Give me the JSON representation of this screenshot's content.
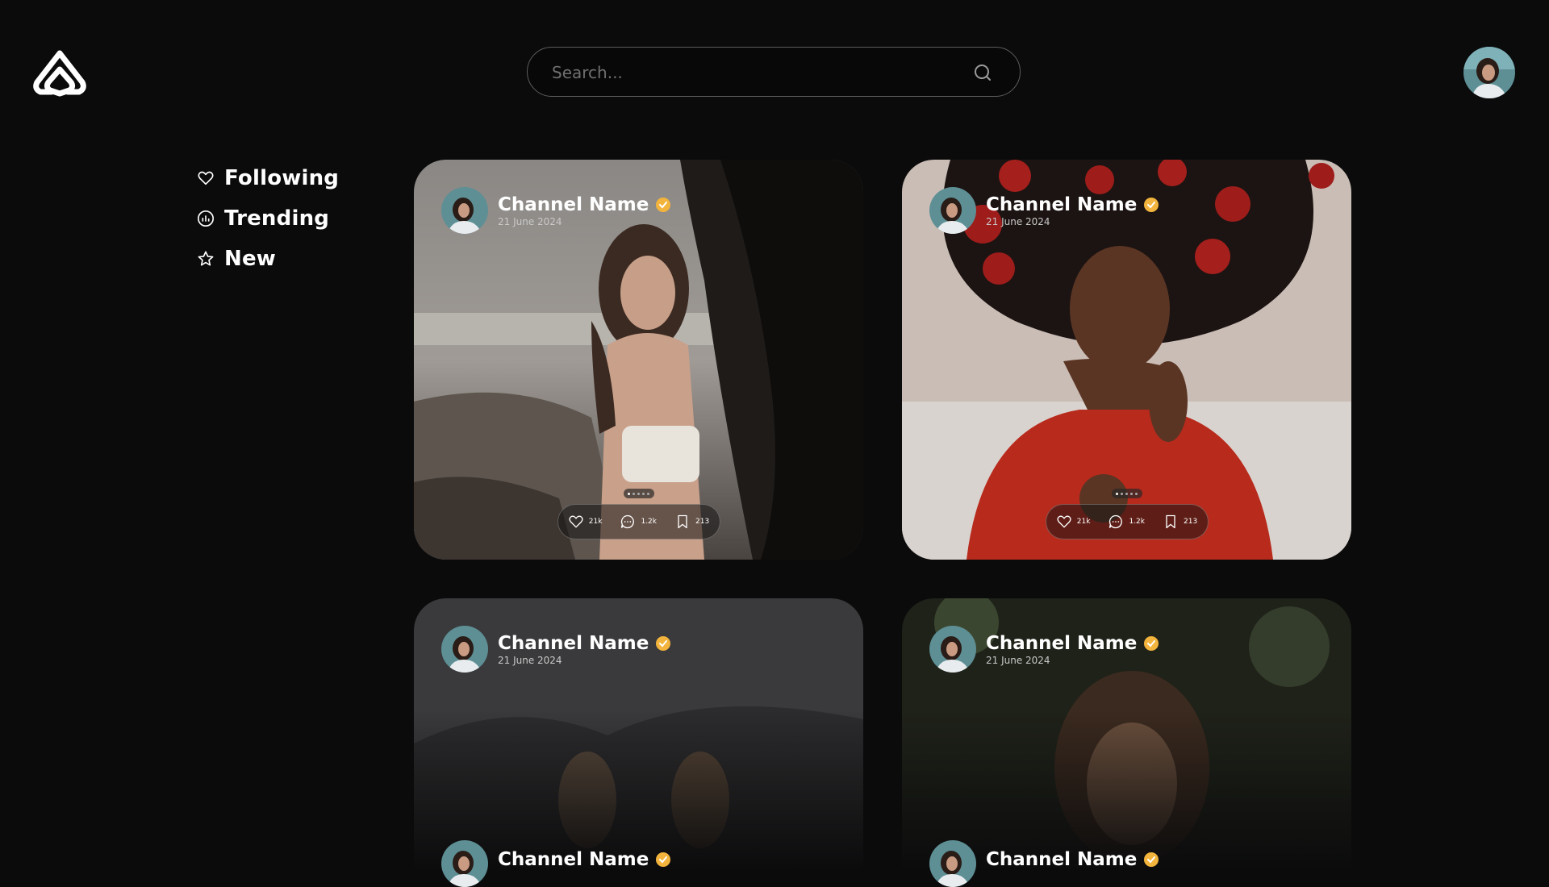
{
  "app": {
    "logo_icon": "brand-logo-icon"
  },
  "search": {
    "placeholder": "Search..."
  },
  "nav": {
    "items": [
      {
        "label": "Following",
        "icon": "heart-icon"
      },
      {
        "label": "Trending",
        "icon": "bar-chart-icon"
      },
      {
        "label": "New",
        "icon": "star-icon"
      }
    ]
  },
  "posts": [
    {
      "channel": "Channel Name",
      "date": "21 June 2024",
      "likes": "21k",
      "comments": "1.2k",
      "saves": "213"
    },
    {
      "channel": "Channel Name",
      "date": "21 June 2024",
      "likes": "21k",
      "comments": "1.2k",
      "saves": "213"
    },
    {
      "channel": "Channel Name",
      "date": "21 June 2024"
    },
    {
      "channel": "Channel Name",
      "date": "21 June 2024"
    },
    {
      "channel": "Channel Name"
    },
    {
      "channel": "Channel Name"
    }
  ],
  "colors": {
    "background": "#0b0b0c",
    "verified_badge": "#f2b43c"
  }
}
